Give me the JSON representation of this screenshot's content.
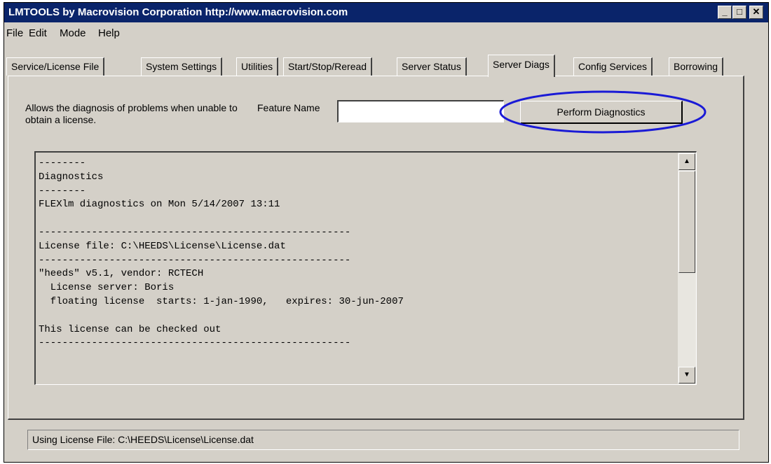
{
  "window": {
    "title": "LMTOOLS by Macrovision Corporation http://www.macrovision.com",
    "controls": {
      "minimize": "_",
      "maximize": "□",
      "close": "✕"
    }
  },
  "menu": [
    "File",
    "Edit",
    "Mode",
    "Help"
  ],
  "tabs": [
    "Service/License File",
    "System Settings",
    "Utilities",
    "Start/Stop/Reread",
    "Server Status",
    "Server Diags",
    "Config Services",
    "Borrowing"
  ],
  "active_tab": "Server Diags",
  "diag": {
    "description": "Allows the diagnosis of problems when unable to obtain a license.",
    "feature_label": "Feature Name",
    "feature_value": "",
    "button_label": "Perform Diagnostics",
    "highlight_color": "#1a1ad6"
  },
  "output": {
    "text": "--------\nDiagnostics\n--------\nFLEXlm diagnostics on Mon 5/14/2007 13:11\n\n-----------------------------------------------------\nLicense file: C:\\HEEDS\\License\\License.dat\n-----------------------------------------------------\n\"heeds\" v5.1, vendor: RCTECH\n  License server: Boris\n  floating license  starts: 1-jan-1990,   expires: 30-jun-2007\n\nThis license can be checked out\n-----------------------------------------------------",
    "scroll_up_icon": "arrow-up",
    "scroll_down_icon": "arrow-down"
  },
  "status": {
    "text": "Using License File:  C:\\HEEDS\\License\\License.dat"
  }
}
